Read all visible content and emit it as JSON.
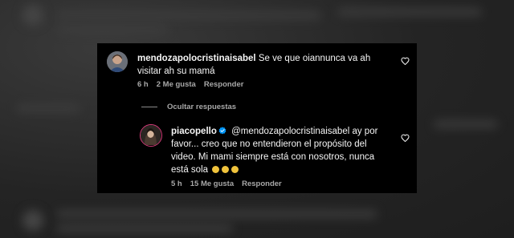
{
  "comment": {
    "username": "mendozapolocristinaisabel",
    "text": "Se ve que oiannunca va ah visitar ah su mamá",
    "time": "6 h",
    "likes": "2 Me gusta",
    "reply_label": "Responder"
  },
  "hide_replies_label": "Ocultar respuestas",
  "reply": {
    "username": "piacopello",
    "text": "@mendozapolocristinaisabel ay por favor... creo que no entendieron el propósito del video. Mi mami siempre está con nosotros, nunca está sola",
    "emojis": [
      "🥲",
      "🥲",
      "🥲"
    ],
    "time": "5 h",
    "likes": "15 Me gusta",
    "reply_label": "Responder"
  },
  "colors": {
    "card_background": "#000000",
    "text": "#f5f5f5",
    "muted": "#a8a8a8",
    "verified": "#0095f6"
  }
}
